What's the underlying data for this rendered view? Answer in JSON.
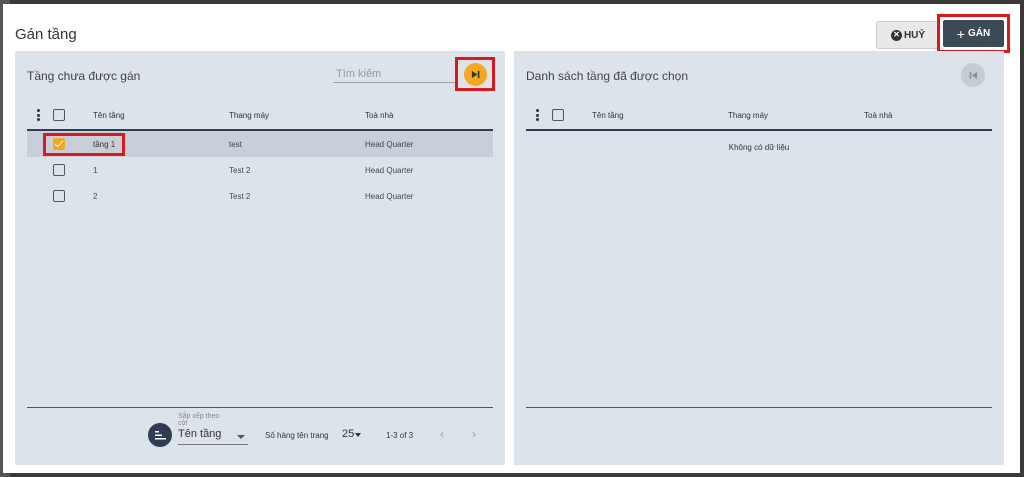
{
  "dialog": {
    "title": "Gán tầng",
    "cancel_label": "HUỶ",
    "cancel_icon": "close-circle-icon",
    "assign_label": "GÁN",
    "assign_icon": "plus-icon"
  },
  "left_panel": {
    "title": "Tầng chưa được gán",
    "search_placeholder": "Tìm kiếm",
    "move_all_icon": "skip-next-icon",
    "columns": [
      "Tên tầng",
      "Thang máy",
      "Toà nhà"
    ],
    "rows": [
      {
        "name": "tầng 1",
        "elevator": "test",
        "building": "Head Quarter",
        "checked": true
      },
      {
        "name": "1",
        "elevator": "Test 2",
        "building": "Head Quarter",
        "checked": false
      },
      {
        "name": "2",
        "elevator": "Test 2",
        "building": "Head Quarter",
        "checked": false
      }
    ],
    "footer": {
      "sort_label": "Sắp xếp theo cột",
      "sort_value": "Tên tầng",
      "rows_per_page_label": "Số hàng tên trang",
      "rows_per_page_value": "25",
      "range": "1-3 of 3",
      "prev_icon": "chevron-left-icon",
      "next_icon": "chevron-right-icon"
    }
  },
  "right_panel": {
    "title": "Danh sách tầng đã được chọn",
    "move_back_icon": "skip-previous-icon",
    "columns": [
      "Tên tầng",
      "Thang máy",
      "Toà nhà"
    ],
    "empty_text": "Không có dữ liệu"
  },
  "colors": {
    "accent": "#f5a623",
    "primary_dark": "#3c4a56",
    "panel_bg": "#dde3ea",
    "highlight_frame": "#d8191f"
  }
}
